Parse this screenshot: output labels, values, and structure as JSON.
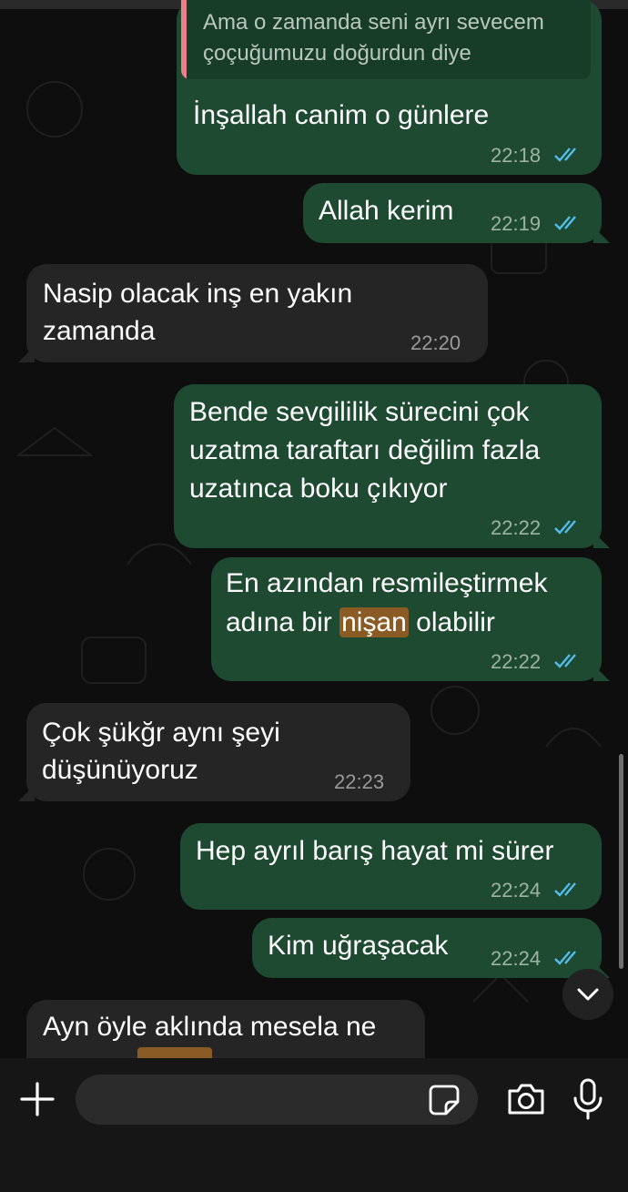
{
  "messages": [
    {
      "dir": "out",
      "quote": {
        "line1": "Ama o zamanda seni ayrı sevecem",
        "line2": "çoçuğumuzu doğurdun diye"
      },
      "text1": "İnşallah canim o günlere",
      "time": "22:18",
      "read": true
    },
    {
      "dir": "out",
      "text1": "Allah kerim",
      "time": "22:19",
      "read": true
    },
    {
      "dir": "in",
      "text1": "Nasip olacak inş en yakın",
      "text2": "zamanda",
      "time": "22:20"
    },
    {
      "dir": "out",
      "text1": "Bende sevgililik sürecini çok",
      "text2": "uzatma taraftarı değilim fazla",
      "text3": "uzatınca boku çıkıyor",
      "time": "22:22",
      "read": true
    },
    {
      "dir": "out",
      "text1": "En azından resmileştirmek",
      "text2_pre": "adına bir ",
      "text2_hl": "nişan",
      "text2_post": " olabilir",
      "time": "22:22",
      "read": true
    },
    {
      "dir": "in",
      "text1": "Çok şükğr aynı şeyi",
      "text2": "düşünüyoruz",
      "time": "22:23"
    },
    {
      "dir": "out",
      "text1": "Hep ayrıl barış hayat mi sürer",
      "time": "22:24",
      "read": true
    },
    {
      "dir": "out",
      "text1": "Kim uğraşacak",
      "time": "22:24",
      "read": true
    },
    {
      "dir": "in",
      "text1": "Ayn öyle aklında mesela ne"
    }
  ],
  "composer": {
    "placeholder": ""
  },
  "icons": {
    "add": "plus-icon",
    "sticker": "sticker-icon",
    "camera": "camera-icon",
    "mic": "microphone-icon",
    "scroll_down": "chevron-down-icon",
    "read_receipt": "double-check-icon"
  },
  "colors": {
    "outgoing_bubble": "#1d4a30",
    "incoming_bubble": "#252525",
    "read_ticks": "#53bdeb",
    "highlight": "#8a5b24",
    "quote_bar": "#e87f89"
  }
}
